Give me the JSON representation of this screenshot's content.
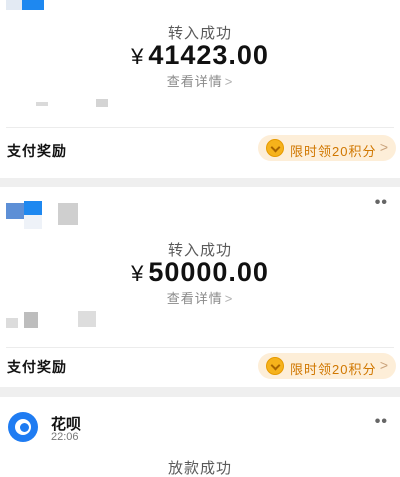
{
  "transfer_1": {
    "status": "转入成功",
    "currency": "¥",
    "amount": "41423.00",
    "detail_link": "查看详情",
    "chevron": ">",
    "reward_label": "支付奖励",
    "reward_offer": "限时领20积分"
  },
  "transfer_2": {
    "status": "转入成功",
    "currency": "¥",
    "amount": "50000.00",
    "detail_link": "查看详情",
    "chevron": ">",
    "more": "••",
    "reward_label": "支付奖励",
    "reward_offer": "限时领20积分"
  },
  "huabei": {
    "name": "花呗",
    "time": "22:06",
    "more": "••",
    "status": "放款成功"
  },
  "colors": {
    "accent_blue": "#1f7cf2",
    "reward_orange": "#d07700",
    "reward_pill_bg": "#fdeed8"
  },
  "icons": {
    "coin": "coin-check-icon",
    "huabei": "huabei-logo-icon",
    "more": "more-dots-icon"
  }
}
